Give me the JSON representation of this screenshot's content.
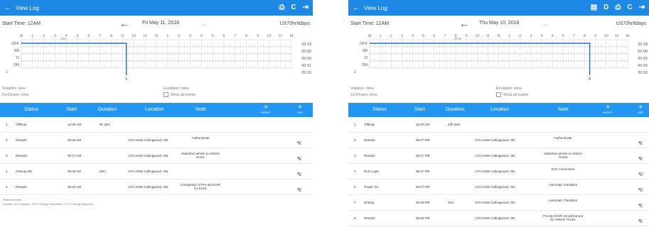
{
  "left": {
    "appbar": {
      "back": "←",
      "title": "View Log",
      "actions": [
        {
          "name": "print-icon",
          "glyph": "⎙"
        },
        {
          "name": "refresh-icon",
          "glyph": "C"
        },
        {
          "name": "exit-icon",
          "glyph": "⇥"
        }
      ]
    },
    "dates": {
      "start_time": "Start Time: 12AM",
      "prev": "←",
      "date": "Fri May 11, 2018",
      "next": "→",
      "ruleset": "US70hr8days"
    },
    "graph": {
      "hours": [
        "M",
        "1",
        "2",
        "3",
        "4",
        "5",
        "6",
        "7",
        "8",
        "9",
        "10",
        "11",
        "N",
        "1",
        "2",
        "3",
        "4",
        "5",
        "6",
        "7",
        "8",
        "9",
        "10",
        "11",
        "M"
      ],
      "rows": [
        "OFF",
        "SB",
        "D",
        "ON"
      ],
      "totals": [
        "09:19",
        "00:00",
        "00:00",
        "00:01",
        "09:20"
      ],
      "marker_top": "9:19",
      "marker_bottom": "5",
      "left_num": "1"
    },
    "info": {
      "violation": "Violation: none",
      "codrivers": "Co-Drivers: none",
      "exception": "Exception: none",
      "show_all": "Show all events"
    },
    "table": {
      "headers": [
        "Status",
        "Start",
        "Duration",
        "Location",
        "Note"
      ],
      "except_label": "EXCEPT",
      "add_label": "ADD",
      "rows": [
        {
          "num": "1",
          "status": "OffDuty",
          "start": "12:00 AM",
          "duration": "9h 19m",
          "location": "",
          "note": "",
          "edit": ""
        },
        {
          "num": "2",
          "status": "Remark",
          "start": "09:16 AM",
          "duration": "",
          "location": "17mi SSW Collingwood, ON",
          "note": "Authenticate",
          "edit": "EDIT"
        },
        {
          "num": "3",
          "status": "Remark",
          "start": "09:17 AM",
          "duration": "",
          "location": "17mi SSW Collingwood, ON",
          "note": "Switched vehicle to vehicle ELD1",
          "edit": "EDIT"
        },
        {
          "num": "4",
          "status": "OnDuty ND",
          "start": "09:19 AM",
          "duration": "00m",
          "location": "17mi SSW Collingwood, ON",
          "note": "",
          "edit": "EDIT"
        },
        {
          "num": "5",
          "status": "Remark",
          "start": "09:20 AM",
          "duration": "",
          "location": "17mi SSW Collingwood, ON",
          "note": "Completion of Pre-trip DVIR for ELD1",
          "edit": "EDIT"
        }
      ]
    },
    "footer": {
      "line1": "*Edited entries",
      "line2": "Inactive: IC=Changed, ICR=Change Requested, ICJ= Change Rejected"
    }
  },
  "right": {
    "appbar": {
      "back": "←",
      "title": "View Log",
      "actions": [
        {
          "name": "message-icon",
          "glyph": "▤"
        },
        {
          "name": "d-icon",
          "glyph": "D"
        },
        {
          "name": "print-icon",
          "glyph": "⎙"
        },
        {
          "name": "refresh-icon",
          "glyph": "C"
        },
        {
          "name": "exit-icon",
          "glyph": "⇥"
        }
      ]
    },
    "dates": {
      "start_time": "Start Time: 12AM",
      "prev": "←",
      "date": "Thu May 10, 2018",
      "next": "→",
      "ruleset": "US70hr8days"
    },
    "graph": {
      "hours": [
        "M",
        "1",
        "2",
        "3",
        "4",
        "5",
        "6",
        "7",
        "8",
        "9",
        "10",
        "11",
        "N",
        "1",
        "2",
        "3",
        "4",
        "5",
        "6",
        "7",
        "8",
        "9",
        "10",
        "11",
        "M"
      ],
      "rows": [
        "OFF",
        "SB",
        "D",
        "ON"
      ],
      "totals": [
        "20:28",
        "00:00",
        "00:02",
        "00:00",
        "20:30"
      ],
      "marker_top": "20:28",
      "marker_bottom": "8",
      "left_num": "1"
    },
    "info": {
      "violation": "Violation: none",
      "codrivers": "Co-Drivers: none",
      "exception": "Exception: none",
      "show_all": "Show all events"
    },
    "table": {
      "headers": [
        "Status",
        "Start",
        "Duration",
        "Location",
        "Note"
      ],
      "except_label": "EXCEPT",
      "add_label": "ADD",
      "rows": [
        {
          "num": "1",
          "status": "OffDuty",
          "start": "12:00 AM",
          "duration": "20h 28m",
          "location": "",
          "note": "",
          "edit": ""
        },
        {
          "num": "2",
          "status": "Remark",
          "start": "08:27 PM",
          "duration": "",
          "location": "17mi SSW Collingwood, ON",
          "note": "Authenticate",
          "edit": "EDIT"
        },
        {
          "num": "3",
          "status": "Remark",
          "start": "08:27 PM",
          "duration": "",
          "location": "17mi SSW Collingwood, ON",
          "note": "Switched vehicle to vehicle Truck1",
          "edit": "EDIT"
        },
        {
          "num": "4",
          "status": "ELD Login",
          "start": "08:27 PM",
          "duration": "",
          "location": "17mi SSW Collingwood, ON",
          "note": "ELD Connection",
          "edit": "NOTE"
        },
        {
          "num": "5",
          "status": "Power On",
          "start": "08:27 PM",
          "duration": "",
          "location": "17mi SSW Collingwood, ON",
          "note": "Automatic Transition",
          "edit": "NOTE"
        },
        {
          "num": "7",
          "status": "Driving",
          "start": "08:28 PM",
          "duration": "02m",
          "location": "17mi SSW Collingwood, ON",
          "note": "Automatic Transition",
          "edit": "EDIT"
        },
        {
          "num": "8",
          "status": "Remark",
          "start": "08:28 PM",
          "duration": "",
          "location": "17mi SSW Collingwood, ON",
          "note": "Pre-trip DVIR not performed for Vehicle Truck1",
          "edit": "EDIT"
        }
      ]
    }
  }
}
